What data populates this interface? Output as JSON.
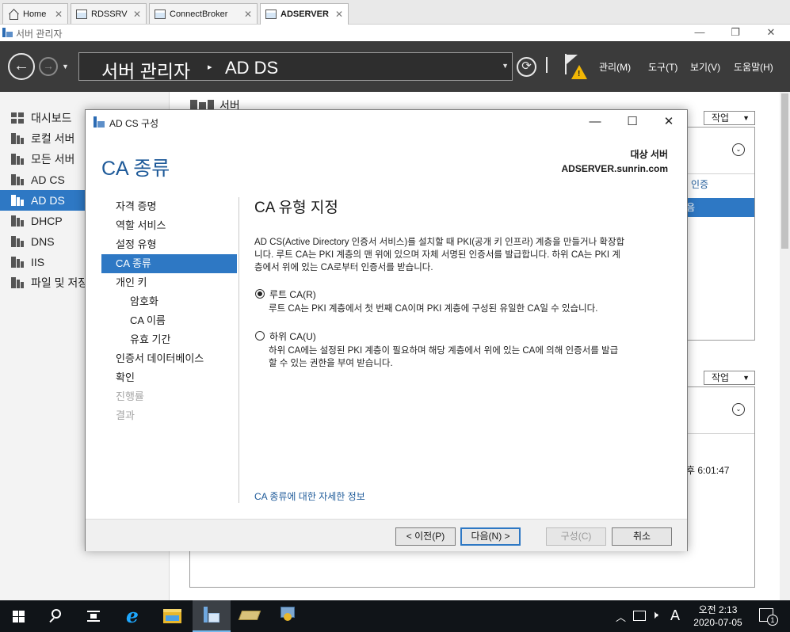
{
  "tabs": [
    {
      "label": "Home",
      "icon": "home-icon"
    },
    {
      "label": "RDSSRV",
      "icon": "remote-desktop-icon"
    },
    {
      "label": "ConnectBroker",
      "icon": "remote-desktop-icon"
    },
    {
      "label": "ADSERVER",
      "icon": "remote-desktop-icon",
      "active": true
    }
  ],
  "server_manager": {
    "window_title": "서버 관리자",
    "breadcrumb": {
      "root": "서버 관리자",
      "current": "AD DS"
    },
    "menu": [
      "관리(M)",
      "도구(T)",
      "보기(V)",
      "도움말(H)"
    ],
    "left_nav": [
      {
        "label": "대시보드",
        "icon": "dashboard-icon"
      },
      {
        "label": "로컬 서버",
        "icon": "local-server-icon"
      },
      {
        "label": "모든 서버",
        "icon": "all-servers-icon"
      },
      {
        "label": "AD CS",
        "icon": "ad-cs-icon"
      },
      {
        "label": "AD DS",
        "icon": "ad-ds-icon",
        "selected": true
      },
      {
        "label": "DHCP",
        "icon": "dhcp-icon"
      },
      {
        "label": "DNS",
        "icon": "dns-icon"
      },
      {
        "label": "IIS",
        "icon": "iis-icon"
      },
      {
        "label": "파일 및 저장",
        "icon": "file-storage-icon"
      }
    ],
    "main": {
      "section_header": "서버",
      "task_label": "작업",
      "partial_col_label": "인증",
      "partial_row_label": "음",
      "partial_time": "후 6:01:47"
    }
  },
  "dialog": {
    "title": "AD CS 구성",
    "heading": "CA 종류",
    "dest_label": "대상 서버",
    "dest_value": "ADSERVER.sunrin.com",
    "steps": [
      {
        "label": "자격 증명",
        "level": 0,
        "state": "normal"
      },
      {
        "label": "역할 서비스",
        "level": 0,
        "state": "normal"
      },
      {
        "label": "설정 유형",
        "level": 0,
        "state": "normal"
      },
      {
        "label": "CA 종류",
        "level": 0,
        "state": "selected"
      },
      {
        "label": "개인 키",
        "level": 0,
        "state": "normal"
      },
      {
        "label": "암호화",
        "level": 1,
        "state": "normal"
      },
      {
        "label": "CA 이름",
        "level": 1,
        "state": "normal"
      },
      {
        "label": "유효 기간",
        "level": 1,
        "state": "normal"
      },
      {
        "label": "인증서 데이터베이스",
        "level": 0,
        "state": "normal"
      },
      {
        "label": "확인",
        "level": 0,
        "state": "normal"
      },
      {
        "label": "진행률",
        "level": 0,
        "state": "disabled"
      },
      {
        "label": "결과",
        "level": 0,
        "state": "disabled"
      }
    ],
    "pane_title": "CA 유형 지정",
    "intro_line1": "AD CS(Active Directory 인증서 서비스)를 설치할 때 PKI(공개 키 인프라) 계층을 만들거나 확장합",
    "intro_line2": "니다. 루트 CA는 PKI 계층의 맨 위에 있으며 자체 서명된 인증서를 발급합니다. 하위 CA는 PKI 계",
    "intro_line3": "층에서 위에 있는 CA로부터 인증서를 받습니다.",
    "options": [
      {
        "label": "루트 CA(R)",
        "selected": true,
        "desc_lines": [
          "루트 CA는 PKI 계층에서 첫 번째 CA이며 PKI 계층에 구성된 유일한 CA일 수 있습니다."
        ]
      },
      {
        "label": "하위 CA(U)",
        "selected": false,
        "desc_lines": [
          "하위 CA에는 설정된 PKI 계층이 필요하며 해당 계층에서 위에 있는 CA에 의해 인증서를 발급",
          "할 수 있는 권한을 부여 받습니다."
        ]
      }
    ],
    "more_link": "CA 종류에 대한 자세한 정보",
    "buttons": {
      "prev": "< 이전(P)",
      "next": "다음(N) >",
      "configure": "구성(C)",
      "cancel": "취소"
    }
  },
  "taskbar": {
    "time": "오전 2:13",
    "date": "2020-07-05",
    "ime": "A",
    "notification_count": "1"
  },
  "colors": {
    "accent": "#2e78c4",
    "heading": "#1e5a99",
    "nav_dark": "#3b3b3b",
    "taskbar": "#101418"
  }
}
